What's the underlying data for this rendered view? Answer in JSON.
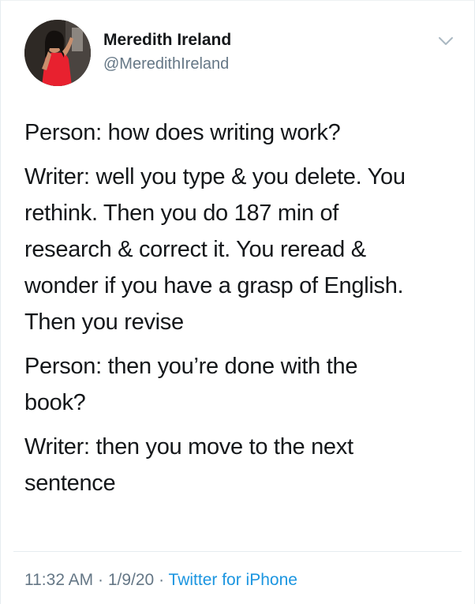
{
  "tweet": {
    "author": {
      "display_name": "Meredith Ireland",
      "handle": "@MeredithIreland",
      "avatar_icon": "profile-photo"
    },
    "menu_icon": "chevron-down-icon",
    "paragraphs": [
      "Person: how does writing work?",
      "Writer: well you type & you delete. You\nrethink. Then you do 187 min of\nresearch & correct it. You reread &\nwonder if you have a grasp of English.\nThen you revise",
      "Person: then you’re done with the\nbook?",
      "Writer: then you move to the next\nsentence"
    ],
    "time": "11:32 AM",
    "separator": " · ",
    "date": "1/9/20",
    "source": "Twitter for iPhone"
  },
  "colors": {
    "text": "#14171a",
    "secondary": "#657786",
    "link": "#1b95e0",
    "border": "#e6ecf0"
  }
}
